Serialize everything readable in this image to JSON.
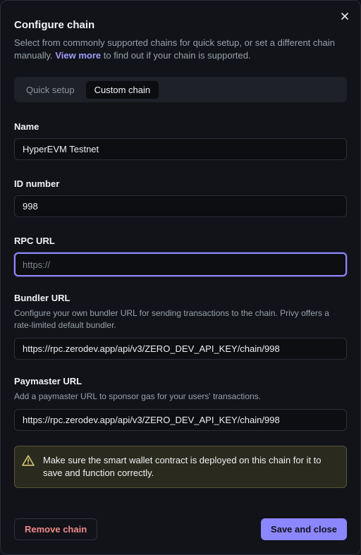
{
  "dialog": {
    "title": "Configure chain",
    "description_prefix": "Select from commonly supported chains for quick setup, or set a different chain manually.",
    "view_more": "View more",
    "description_suffix": "to find out if your chain is supported."
  },
  "tabs": [
    {
      "label": "Quick setup",
      "active": false
    },
    {
      "label": "Custom chain",
      "active": true
    }
  ],
  "fields": {
    "name": {
      "label": "Name",
      "value": "HyperEVM Testnet"
    },
    "id_number": {
      "label": "ID number",
      "value": "998"
    },
    "rpc_url": {
      "label": "RPC URL",
      "value": "",
      "placeholder": "https://"
    },
    "bundler_url": {
      "label": "Bundler URL",
      "help": "Configure your own bundler URL for sending transactions to the chain. Privy offers a rate-limited default bundler.",
      "value": "https://rpc.zerodev.app/api/v3/ZERO_DEV_API_KEY/chain/998"
    },
    "paymaster_url": {
      "label": "Paymaster URL",
      "help": "Add a paymaster URL to sponsor gas for your users' transactions.",
      "value": "https://rpc.zerodev.app/api/v3/ZERO_DEV_API_KEY/chain/998"
    }
  },
  "warning": {
    "text": "Make sure the smart wallet contract is deployed on this chain for it to save and function correctly."
  },
  "actions": {
    "remove_label": "Remove chain",
    "save_label": "Save and close"
  },
  "colors": {
    "accent": "#8c86ff",
    "danger": "#ef8a8a",
    "warning_icon": "#e8d27a"
  },
  "icons": {
    "close": "close-icon",
    "warning": "warning-triangle-icon"
  }
}
